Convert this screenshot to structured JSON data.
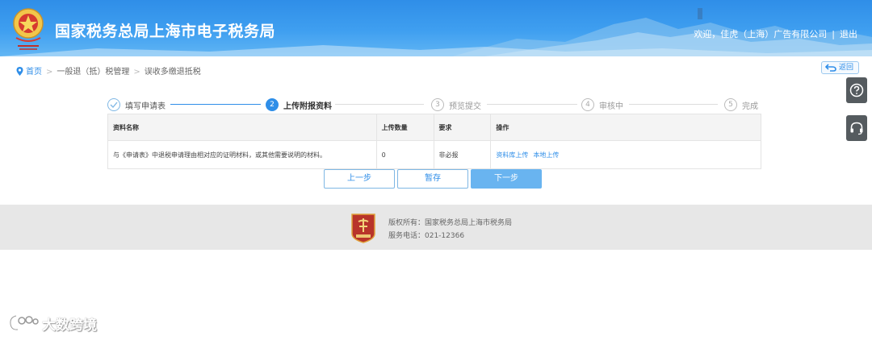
{
  "header": {
    "title": "国家税务总局上海市电子税务局",
    "welcome": "欢迎，佳虎（上海）广告有限公司",
    "separator": "|",
    "logout": "退出"
  },
  "breadcrumb": {
    "home": "首页",
    "level2": "一般退（抵）税管理",
    "level3": "误收多缴退抵税"
  },
  "back_label": "返回",
  "steps": [
    {
      "num": "✓",
      "label": "填写申请表",
      "state": "done"
    },
    {
      "num": "2",
      "label": "上传附报资料",
      "state": "active"
    },
    {
      "num": "3",
      "label": "预览提交",
      "state": "pending"
    },
    {
      "num": "4",
      "label": "审核中",
      "state": "pending"
    },
    {
      "num": "5",
      "label": "完成",
      "state": "pending"
    }
  ],
  "table": {
    "headers": [
      "资料名称",
      "上传数量",
      "要求",
      "操作"
    ],
    "rows": [
      {
        "name": "与《申请表》中退税申请理由相对应的证明材料，或其他需要说明的材料。",
        "count": "0",
        "requirement": "非必报",
        "actions": [
          "资料库上传",
          "本地上传"
        ]
      }
    ]
  },
  "buttons": {
    "prev": "上一步",
    "save": "暂存",
    "next": "下一步"
  },
  "footer": {
    "copyright": "版权所有：国家税务总局上海市税务局",
    "phone": "服务电话：021-12366"
  },
  "watermark": "大数跨境",
  "colors": {
    "header_blue": "#2f8ee8",
    "accent": "#2f8ee8",
    "next_button": "#69b4f0",
    "footer_bg": "#e7e7e7",
    "side_tool": "#555b5f"
  }
}
